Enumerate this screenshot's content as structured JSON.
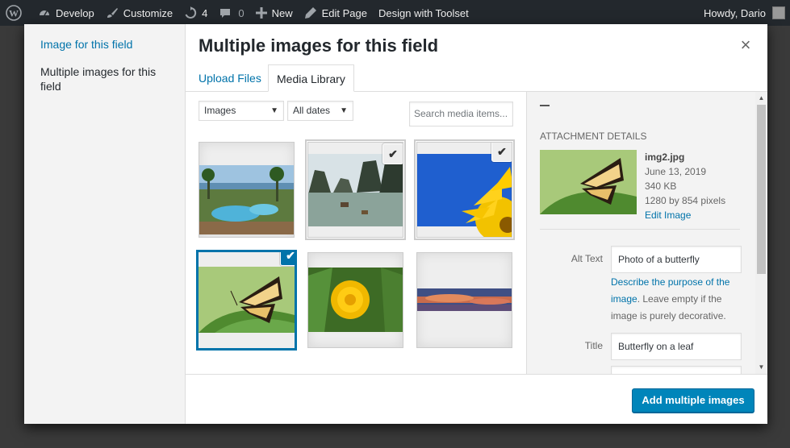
{
  "adminbar": {
    "items": [
      {
        "label": "",
        "icon": "wordpress-logo-icon"
      },
      {
        "label": "Develop",
        "icon": "dashboard-icon"
      },
      {
        "label": "Customize",
        "icon": "brush-icon"
      },
      {
        "label": "4",
        "icon": "updates-icon"
      },
      {
        "label": "0",
        "icon": "comment-icon"
      },
      {
        "label": "New",
        "icon": "plus-icon"
      },
      {
        "label": "Edit Page",
        "icon": "pencil-icon"
      },
      {
        "label": "Design with Toolset",
        "icon": ""
      }
    ],
    "greeting": "Howdy, Dario"
  },
  "menu": {
    "items": [
      {
        "label": "Image for this field",
        "active": false
      },
      {
        "label": "Multiple images for this field",
        "active": true
      }
    ]
  },
  "frame": {
    "title": "Multiple images for this field",
    "close_glyph": "×"
  },
  "router": {
    "tabs": [
      {
        "label": "Upload Files",
        "active": false
      },
      {
        "label": "Media Library",
        "active": true
      }
    ]
  },
  "filters": {
    "type": "Images",
    "date": "All dates",
    "search_placeholder": "Search media items..."
  },
  "attachments": [
    {
      "name": "resort-pool",
      "selected": false
    },
    {
      "name": "bay-islands",
      "selected": true
    },
    {
      "name": "sunflower-sky",
      "selected": true
    },
    {
      "name": "butterfly-leaf",
      "selected": true,
      "active": true
    },
    {
      "name": "dandelion",
      "selected": false
    },
    {
      "name": "sunset-clouds",
      "selected": false
    }
  ],
  "details": {
    "heading": "Attachment Details",
    "filename": "img2.jpg",
    "date": "June 13, 2019",
    "size": "340 KB",
    "dimensions": "1280 by 854 pixels",
    "edit_link": "Edit Image",
    "alt_label": "Alt Text",
    "alt_value": "Photo of a butterfly",
    "alt_desc_link": "Describe the purpose of the image",
    "alt_desc_rest": ". Leave empty if the image is purely decorative.",
    "title_label": "Title",
    "title_value": "Butterfly on a leaf"
  },
  "toolbar": {
    "button_label": "Add multiple images"
  },
  "colors": {
    "accent": "#0073aa",
    "button": "#0085ba",
    "adminbar": "#23282d"
  }
}
